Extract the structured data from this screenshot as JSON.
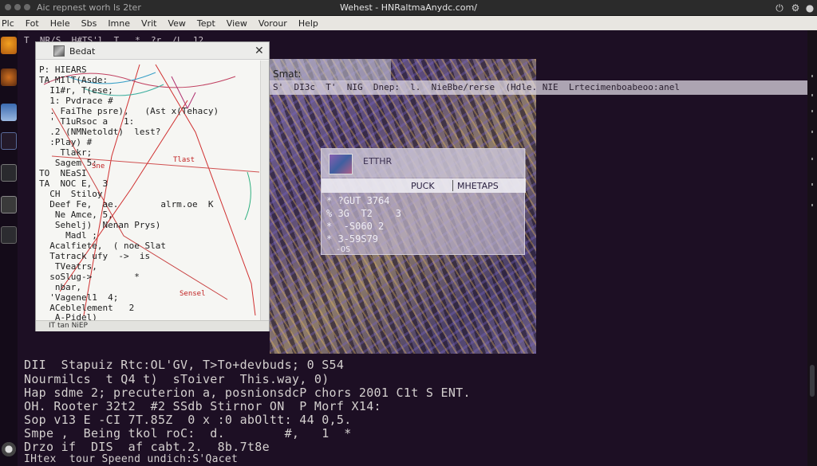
{
  "window": {
    "left_title": "Aic  repnest worh  ls  2ter",
    "title": "Wehest - HNRaltmaAnydc.com/"
  },
  "menu": [
    "Plc",
    "Fot",
    "Hele",
    "Sbs",
    "Imne",
    "Vrit",
    "Vew",
    "Tept",
    "View",
    "Vorour",
    "Help"
  ],
  "terminal": {
    "top_text": "T  NR/S  H#TS'l  T   *  ?r  /L  12",
    "lines": [
      "DII  Stapuiz Rtc:OL'GV, T>To+devbuds; 0 S54",
      "Nourmilcs  t Q4 t)  sToiver  This.way, 0)",
      "Hap sdme 2; precuterion a, posnionsdcP chors 2001 C1t S ENT.",
      "OH. Rooter 32t2  #2 SSdb Stirnor ON  P Morf X14:",
      "Sop v13 E -CI 7T.85Z  0 x :0 abOltt: 44 0,5.",
      "Smpe ,  Being tkol roC:  d.        #,   1  *",
      "Drzo if  DIS  af cabt.2.  8b.7t8e",
      "IHtex  tour Speend undich:S'Qacet"
    ]
  },
  "image_panel": {
    "label": "Smat:",
    "info": "S'  DI3c  T'  NIG  Dnep:  l.  NieBbe/rerse  (Hdle. NIE  Lrtecimenboabeoo:anel"
  },
  "dialog_main": {
    "title": "Bedat",
    "status": "IT  tan  NiEP",
    "lines": [
      "P: HIEARS",
      "TA MIlT(Asde:",
      "  I1#r, T(ese;",
      "  1: Pvdrace #",
      "  . FaiThe psre),   (Ast x(Tehacy)",
      "  ' T1uRsoc a   1:",
      "  .2 (NMNetoldt)  lest?",
      "  :Play) #",
      "    Tlakr;",
      "   Sagem 5:",
      "TO  NEaSI",
      "TA  NOC E,  3",
      "  CH  Stiloy",
      "  Deef Fe,  ae.        alrm.oe  K",
      "   Ne Amce, 5,",
      "   Sehelj)  Nenan Prys)",
      "     Madl ;",
      "  Acalfiete,  ( noe Slat",
      "  Tatrack ufy  ->  is",
      "   TVeatrs,",
      "  soSlug->        *",
      "   nbar,",
      "  'Vagenel1  4;",
      "  ACeblelement   2",
      "   A-Pidel)"
    ],
    "notes": [
      "Tlast",
      "Sne",
      "Sensel"
    ]
  },
  "dialog_small": {
    "title": "ETTHR",
    "tab_left": "PUCK",
    "tab_right": "MHETAPS",
    "rows": [
      "* ?GUT 3764",
      "% 3G  T2    3",
      "*  -S060 2",
      "* 3-59S79",
      "  -OS"
    ]
  }
}
